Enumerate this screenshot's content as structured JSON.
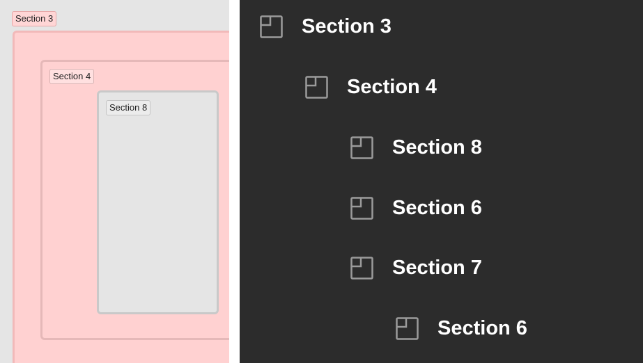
{
  "canvas": {
    "section_3_tag": "Section 3",
    "section_4_tag": "Section 4",
    "section_8_tag": "Section 8"
  },
  "layers": {
    "items": [
      {
        "label": "Section 3",
        "icon": "section-icon"
      },
      {
        "label": "Section 4",
        "icon": "section-icon"
      },
      {
        "label": "Section 8",
        "icon": "section-icon"
      },
      {
        "label": "Section 6",
        "icon": "section-icon"
      },
      {
        "label": "Section 7",
        "icon": "section-icon"
      },
      {
        "label": "Section 6",
        "icon": "section-icon"
      }
    ]
  },
  "colors": {
    "canvas_bg": "#e5e5e5",
    "section_fill": "#ffd1d1",
    "panel_bg": "#2c2c2c",
    "label_text": "#ffffff",
    "icon_stroke": "#9b9b9b"
  }
}
